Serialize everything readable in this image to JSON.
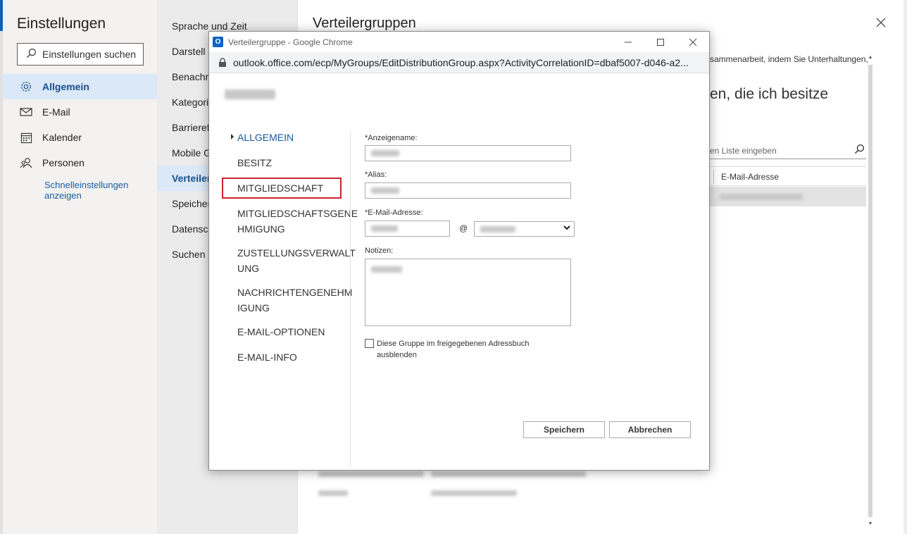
{
  "settings": {
    "title": "Einstellungen",
    "search_label": "Einstellungen suchen",
    "nav": [
      {
        "label": "Allgemein",
        "icon": "gear-icon",
        "active": true
      },
      {
        "label": "E-Mail",
        "icon": "mail-icon",
        "active": false
      },
      {
        "label": "Kalender",
        "icon": "calendar-icon",
        "active": false
      },
      {
        "label": "Personen",
        "icon": "people-icon",
        "active": false
      }
    ],
    "quick_link": "Schnelleinstellungen anzeigen"
  },
  "submenu": {
    "items": [
      "Sprache und Zeit",
      "Darstell",
      "Benachri",
      "Kategori",
      "Barrieref",
      "Mobile G",
      "Verteiler",
      "Speicher",
      "Datensch",
      "Suchen"
    ],
    "active_index": 6
  },
  "content": {
    "title": "Verteilergruppen",
    "description_fragment": "sammenarbeit, indem Sie Unterhaltungen,",
    "subheading_fragment": "en, die ich besitze",
    "search_placeholder_fragment": "en Liste eingeben",
    "column_email": "E-Mail-Adresse"
  },
  "popup": {
    "window_title": "Verteilergruppe - Google Chrome",
    "url": "outlook.office.com/ecp/MyGroups/EditDistributionGroup.aspx?ActivityCorrelationID=dbaf5007-d046-a2...",
    "tabs": [
      "ALLGEMEIN",
      "BESITZ",
      "MITGLIEDSCHAFT",
      "MITGLIEDSCHAFTSGENE HMIGUNG",
      "ZUSTELLUNGSVERWALT UNG",
      "NACHRICHTENGENEHM IGUNG",
      "E-MAIL-OPTIONEN",
      "E-MAIL-INFO"
    ],
    "active_tab_index": 0,
    "highlighted_tab_index": 2,
    "form": {
      "display_name_label": "*Anzeigename:",
      "alias_label": "*Alias:",
      "email_label": "*E-Mail-Adresse:",
      "at_sign": "@",
      "notes_label": "Notizen:",
      "hide_checkbox_label": "Diese Gruppe im freigegebenen Adressbuch ausblenden"
    },
    "save_label": "Speichern",
    "cancel_label": "Abbrechen"
  },
  "colors": {
    "accent": "#1a5a9c",
    "active_nav_bg": "#dae8f8",
    "highlight_border": "#c8232c"
  }
}
